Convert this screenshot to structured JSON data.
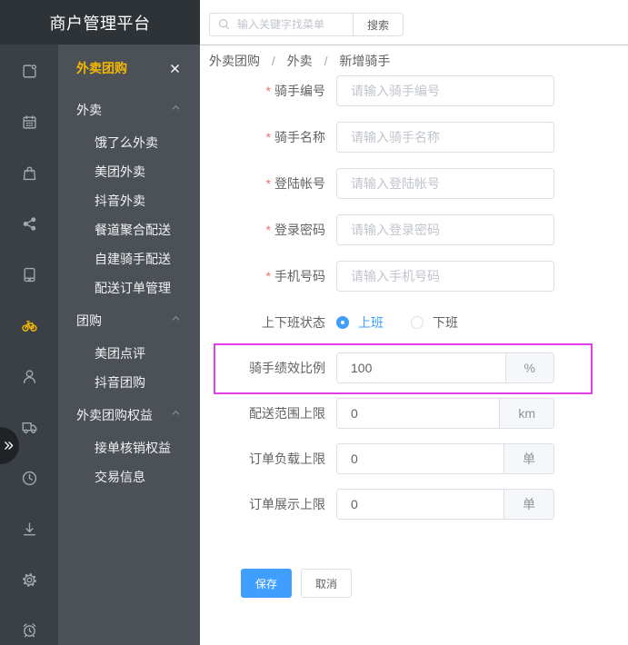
{
  "app": {
    "title": "商户管理平台"
  },
  "theme": {
    "accent": "#409eff",
    "active": "#f5b800",
    "required": "#f56c6c",
    "highlight": "#e23de6"
  },
  "rail": {
    "icons": [
      "new-document-icon",
      "calendar-icon",
      "bag-icon",
      "share-icon",
      "tablet-icon",
      "bike-icon",
      "user-icon",
      "truck-icon",
      "clock-icon",
      "download-icon",
      "gear-icon",
      "alarm-icon"
    ],
    "active_icon": "bike-icon",
    "toggle_icon": "double-chevron-right-icon"
  },
  "submenu": {
    "title": "外卖团购",
    "close_icon": "close-icon",
    "group_toggle_icon": "chevron-up-icon",
    "groups": [
      {
        "label": "外卖",
        "items": [
          "饿了么外卖",
          "美团外卖",
          "抖音外卖",
          "餐道聚合配送",
          "自建骑手配送",
          "配送订单管理"
        ]
      },
      {
        "label": "团购",
        "items": [
          "美团点评",
          "抖音团购"
        ]
      },
      {
        "label": "外卖团购权益",
        "items": [
          "接单核销权益",
          "交易信息"
        ]
      }
    ]
  },
  "search": {
    "icon": "search-icon",
    "placeholder": "输入关键字找菜单",
    "button_label": "搜索"
  },
  "breadcrumb": {
    "separator": "/",
    "items": [
      "外卖团购",
      "外卖",
      "新增骑手"
    ]
  },
  "form": {
    "required_mark": "*",
    "fields": [
      {
        "label": "骑手编号",
        "required": true,
        "placeholder": "请输入骑手编号"
      },
      {
        "label": "骑手名称",
        "required": true,
        "placeholder": "请输入骑手名称"
      },
      {
        "label": "登陆帐号",
        "required": true,
        "placeholder": "请输入登陆帐号"
      },
      {
        "label": "登录密码",
        "required": true,
        "placeholder": "请输入登录密码"
      },
      {
        "label": "手机号码",
        "required": true,
        "placeholder": "请输入手机号码"
      },
      {
        "label": "上下班状态",
        "options": [
          "上班",
          "下班"
        ],
        "selected_index": 0
      },
      {
        "label": "骑手绩效比例",
        "value": "100",
        "suffix": "%"
      },
      {
        "label": "配送范围上限",
        "value": "0",
        "suffix": "km"
      },
      {
        "label": "订单负载上限",
        "value": "0",
        "suffix": "单"
      },
      {
        "label": "订单展示上限",
        "value": "0",
        "suffix": "单"
      }
    ],
    "save_label": "保存",
    "cancel_label": "取消"
  }
}
